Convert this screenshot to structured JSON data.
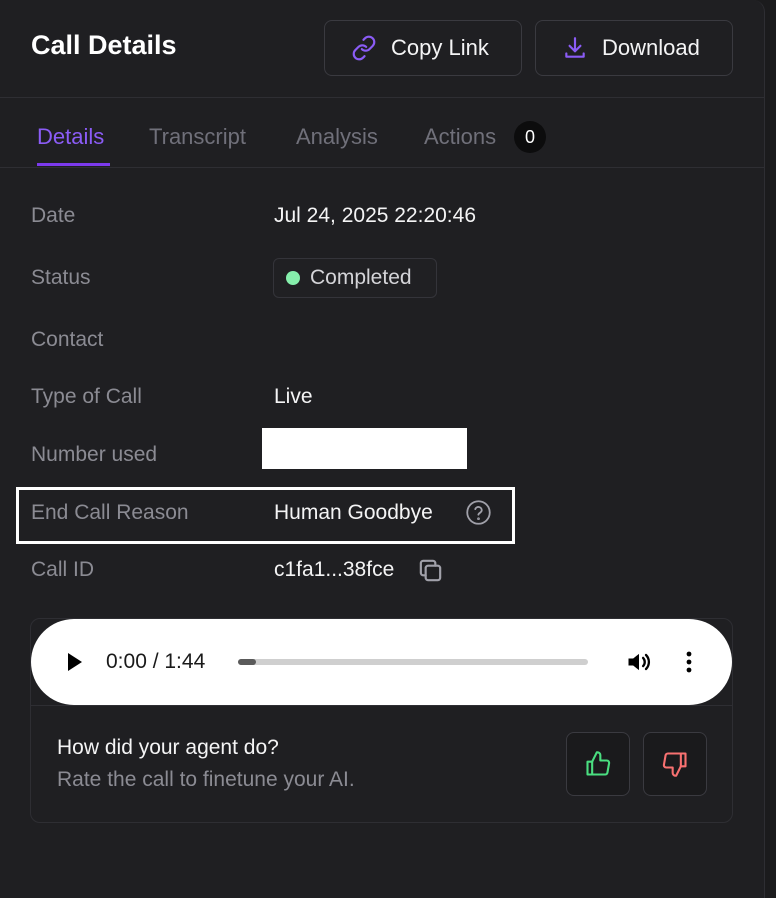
{
  "header": {
    "title": "Call Details",
    "copy_link_label": "Copy Link",
    "download_label": "Download"
  },
  "tabs": [
    {
      "label": "Details",
      "active": true
    },
    {
      "label": "Transcript",
      "active": false
    },
    {
      "label": "Analysis",
      "active": false
    },
    {
      "label": "Actions",
      "active": false,
      "badge": "0"
    }
  ],
  "details": {
    "date_label": "Date",
    "date_value": "Jul 24, 2025 22:20:46",
    "status_label": "Status",
    "status_value": "Completed",
    "contact_label": "Contact",
    "type_label": "Type of Call",
    "type_value": "Live",
    "number_label": "Number used",
    "end_reason_label": "End Call Reason",
    "end_reason_value": "Human Goodbye",
    "call_id_label": "Call ID",
    "call_id_value": "c1fa1...38fce"
  },
  "player": {
    "time": "0:00 / 1:44",
    "progress_fraction": 0.05
  },
  "feedback": {
    "question": "How did your agent do?",
    "subtitle": "Rate the call to finetune your AI."
  },
  "colors": {
    "accent": "#8b5cf6",
    "status_dot": "#86efac",
    "thumbs_up": "#4ade80",
    "thumbs_down": "#f87171"
  },
  "icons": [
    "link-icon",
    "download-icon",
    "help-icon",
    "copy-icon",
    "play-icon",
    "volume-icon",
    "more-vertical-icon",
    "thumbs-up-icon",
    "thumbs-down-icon"
  ]
}
